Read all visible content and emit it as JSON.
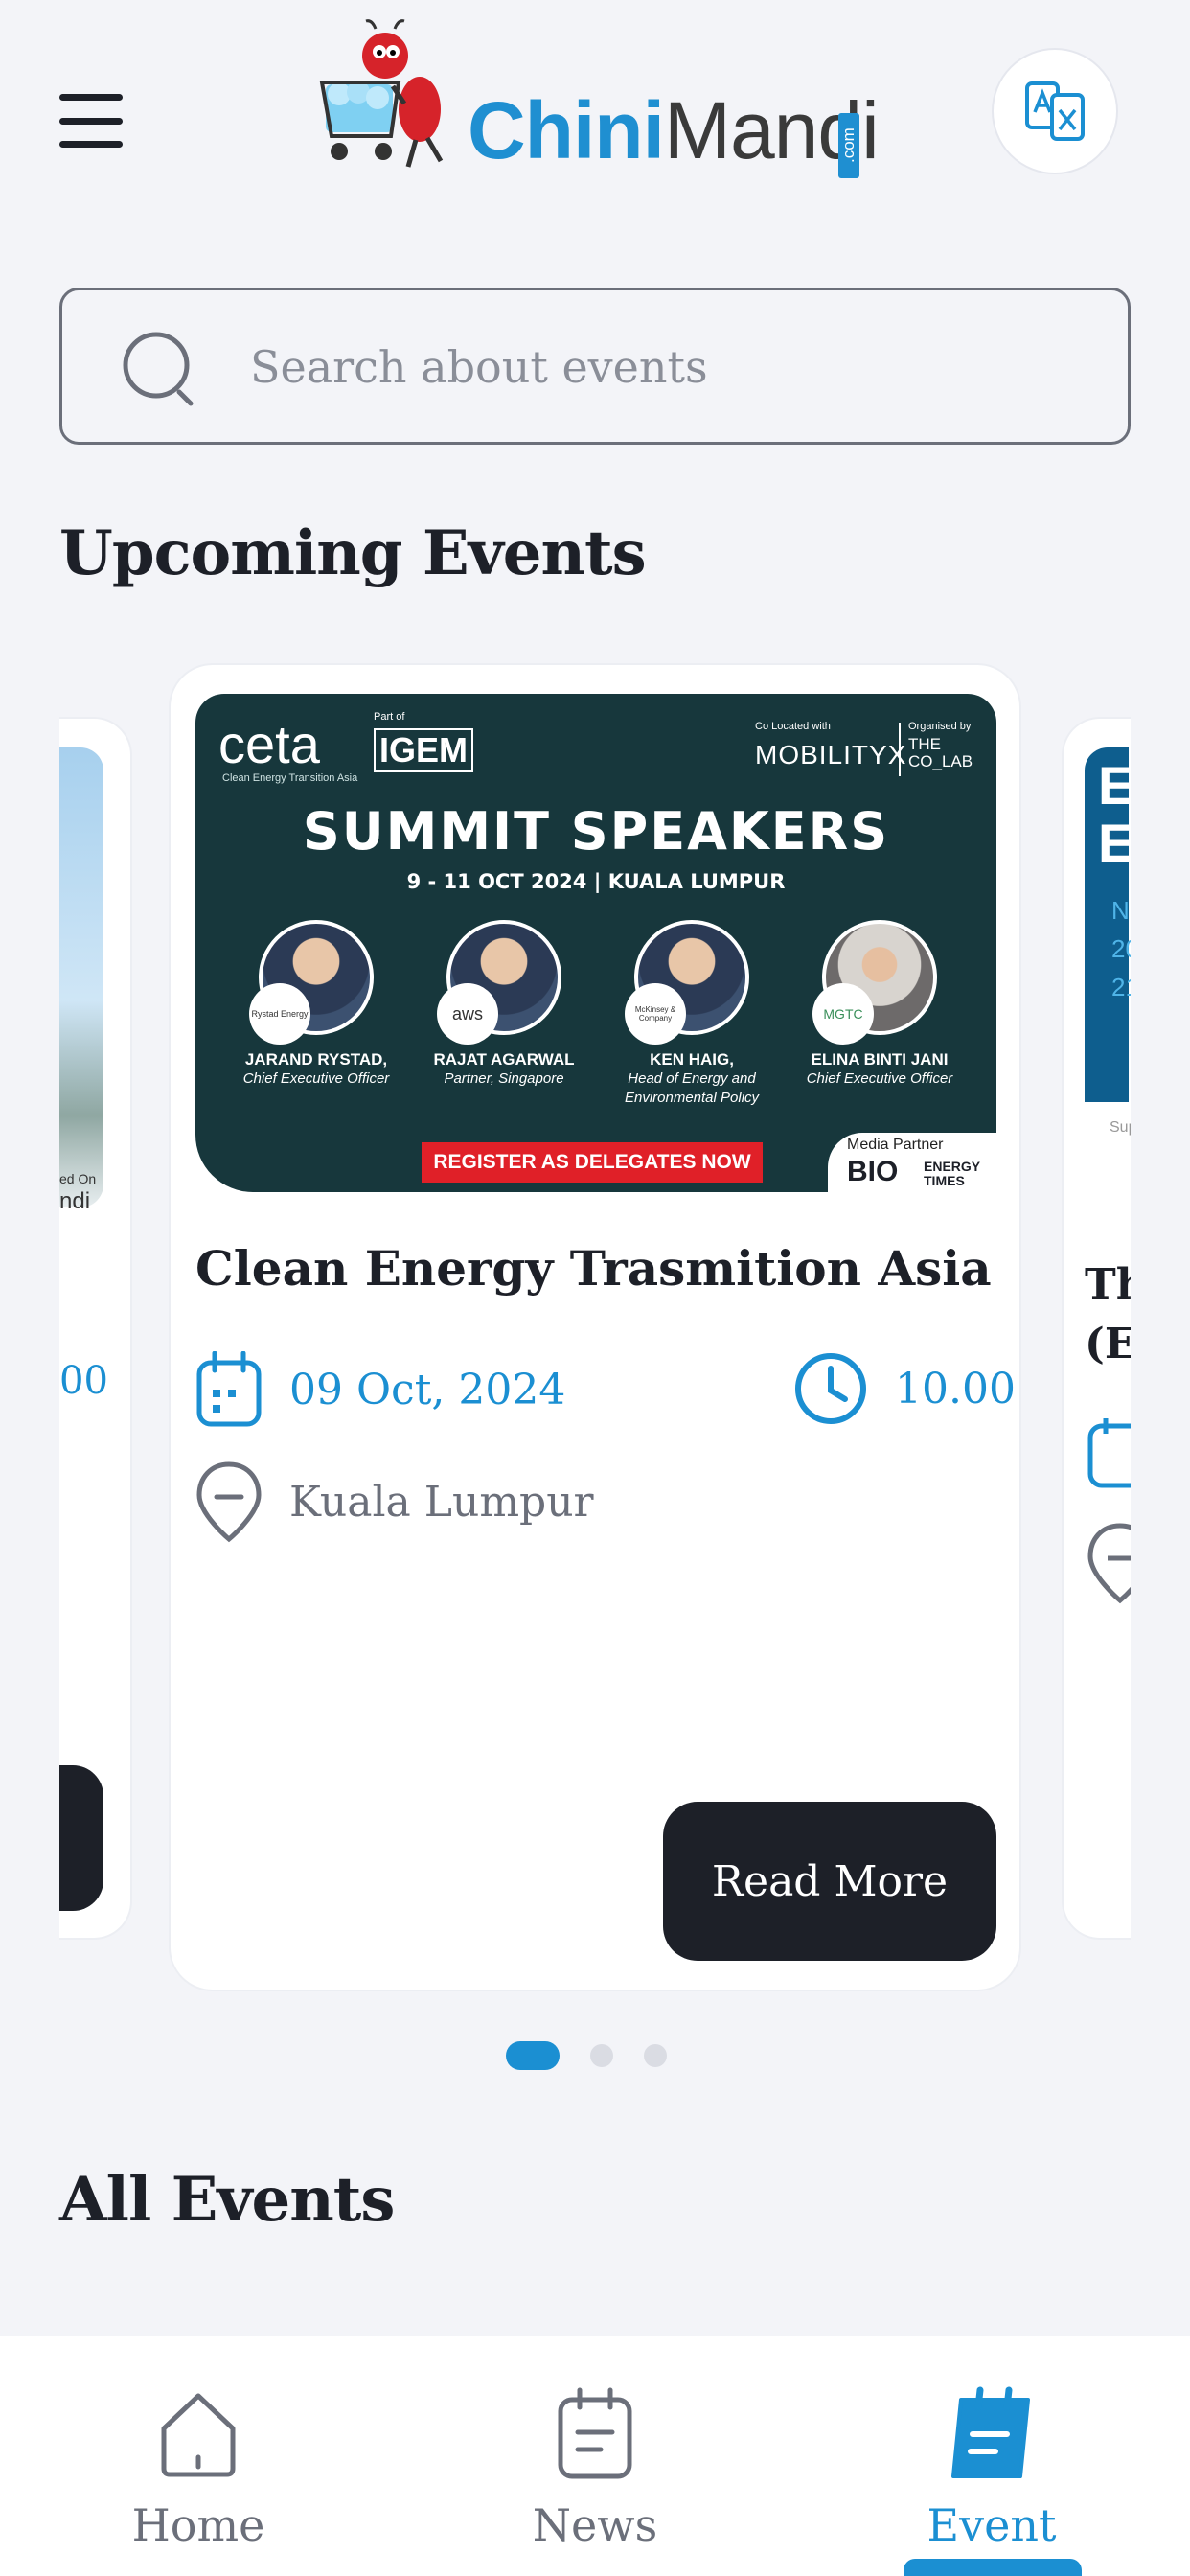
{
  "header": {
    "menu_icon": "hamburger-menu-icon",
    "logo_text_blue": "Chini",
    "logo_text_dark": "Mandi",
    "logo_suffix": ".com",
    "translate_icon": "translate-icon"
  },
  "search": {
    "placeholder": "Search about events",
    "value": "",
    "icon": "search-icon"
  },
  "sections": {
    "upcoming_title": "Upcoming Events",
    "all_title": "All Events"
  },
  "carousel": {
    "active_index": 0,
    "dot_count": 3,
    "left_card_partial": {
      "caption_line1": "ed On",
      "caption_line2": "ndi",
      "time_fragment": "00"
    },
    "right_card_partial": {
      "title_fragment_1": "Th",
      "title_fragment_2": "(El",
      "banner_fragment_1": "E",
      "banner_fragment_2": "E",
      "banner_fragment_3": "N",
      "banner_fragment_4": "20",
      "banner_fragment_5": "21",
      "banner_fragment_6": "Sup"
    },
    "main_card": {
      "banner": {
        "brand": "ceta",
        "brand_sub": "Clean Energy Transition Asia",
        "part_of": "Part of",
        "partner_logo": "IGEM",
        "co_located": "Co Located with",
        "mobility": "MOBILITYX",
        "organised_by": "Organised by",
        "collab": "THE CO_LAB",
        "headline": "SUMMIT SPEAKERS",
        "dates": "9 - 11 OCT 2024 | KUALA LUMPUR",
        "speakers": [
          {
            "name": "JARAND RYSTAD,",
            "role": "Chief Executive Officer",
            "org": "Rystad Energy"
          },
          {
            "name": "RAJAT AGARWAL",
            "role": "Partner, Singapore",
            "org": "aws"
          },
          {
            "name": "KEN HAIG,",
            "role": "Head of Energy and Environmental Policy",
            "org": "McKinsey & Company"
          },
          {
            "name": "ELINA BINTI JANI",
            "role": "Chief Executive Officer",
            "org": "MGTC"
          }
        ],
        "cta": "REGISTER AS DELEGATES NOW",
        "media_partner_label": "Media Partner",
        "media_partner_logo": "BIO",
        "media_partner_sub": "ENERGY TIMES"
      },
      "title": "Clean Energy Trasmition Asia",
      "date": "09 Oct, 2024",
      "date_icon": "calendar-icon",
      "time": "10.00",
      "time_icon": "clock-icon",
      "location": "Kuala Lumpur",
      "location_icon": "location-pin-icon",
      "read_more": "Read More"
    }
  },
  "bottom_nav": {
    "items": [
      {
        "label": "Home",
        "icon": "home-icon",
        "active": false
      },
      {
        "label": "News",
        "icon": "news-icon",
        "active": false
      },
      {
        "label": "Event",
        "icon": "event-icon",
        "active": true
      }
    ]
  },
  "colors": {
    "accent": "#1b8fd2",
    "dark": "#1d2028",
    "background": "#f3f4f8",
    "muted": "#6b6f7a"
  }
}
